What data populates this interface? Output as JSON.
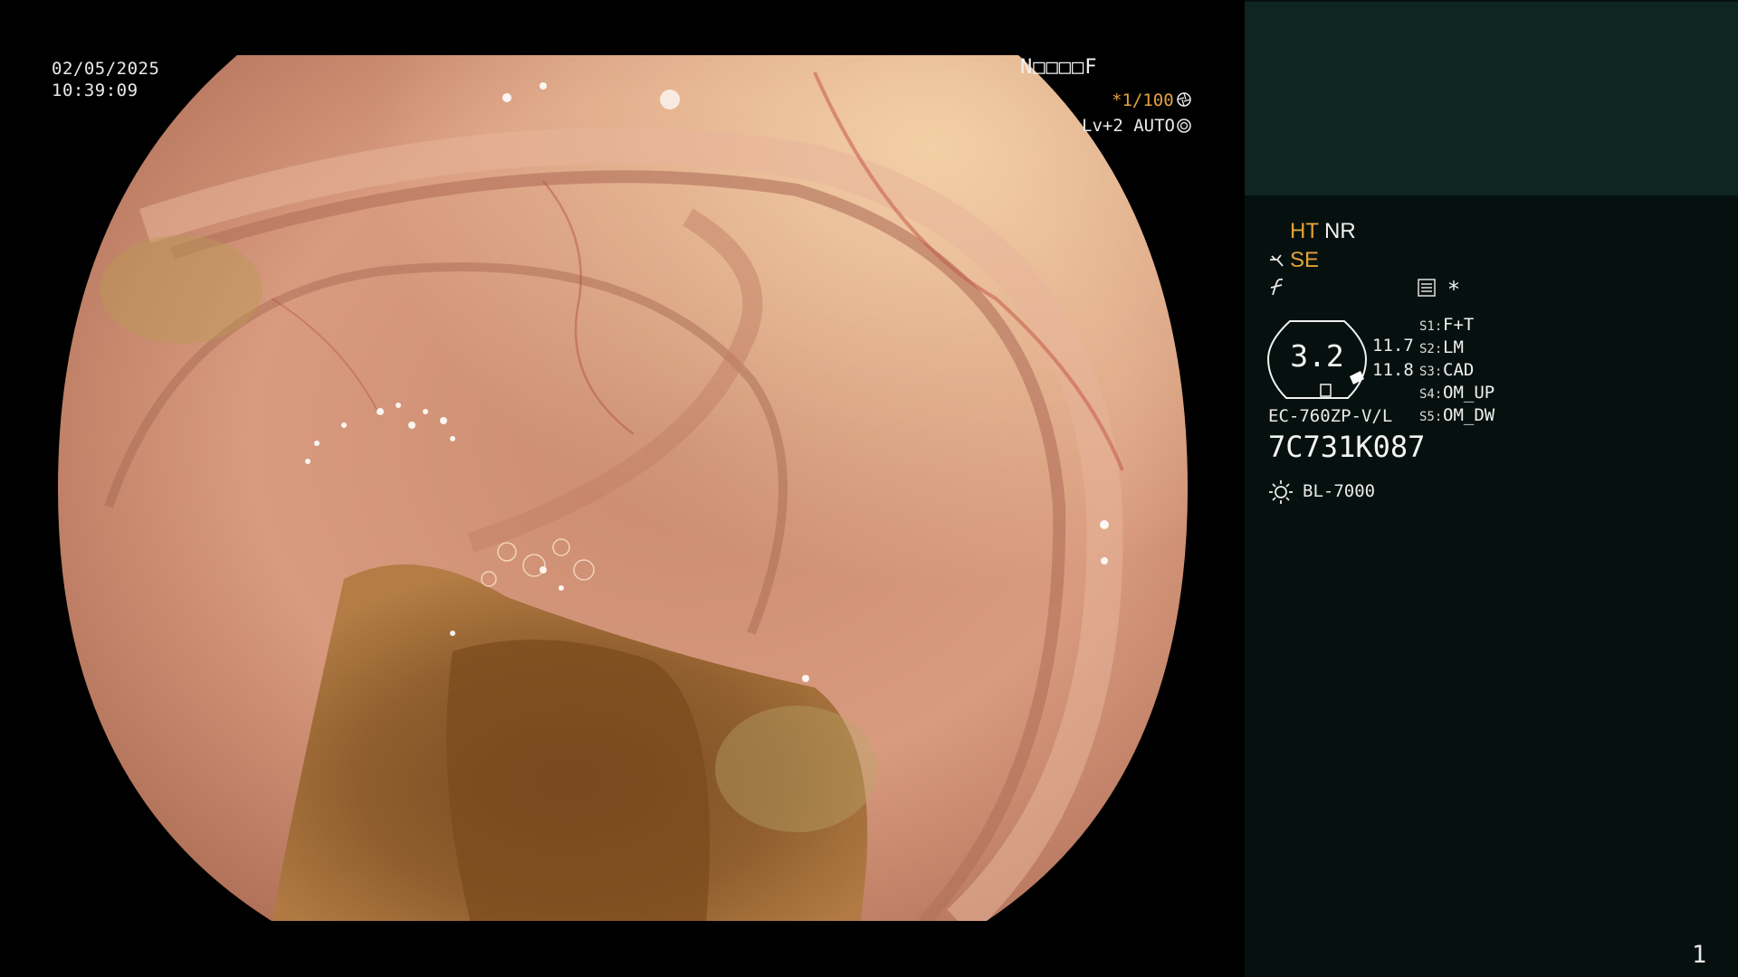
{
  "overlay": {
    "date": "02/05/2025",
    "time": "10:39:09",
    "patient_id": "N□□□□F",
    "shutter": "*1/100",
    "shutter_icon": "aperture-icon",
    "level": "Lv+2 AUTO",
    "level_icon": "iris-icon"
  },
  "panel": {
    "ht": "HT",
    "nr": "NR",
    "se": "SE",
    "menu_icon": "menu-icon",
    "star": "*",
    "zoom": "3.2",
    "num1": "11.7",
    "num2": "11.8",
    "scope_model": "EC-760ZP-V/L",
    "serial": "7C731K087",
    "light_source": "BL-7000",
    "settings": [
      {
        "key": "S1:",
        "value": "F+T"
      },
      {
        "key": "S2:",
        "value": "LM"
      },
      {
        "key": "S3:",
        "value": "CAD"
      },
      {
        "key": "S4:",
        "value": "OM_UP"
      },
      {
        "key": "S5:",
        "value": "OM_DW"
      }
    ],
    "page": "1"
  },
  "colors": {
    "accent": "#e3a23a",
    "panel_bg": "#06110f",
    "panel_top": "#0f2521"
  }
}
